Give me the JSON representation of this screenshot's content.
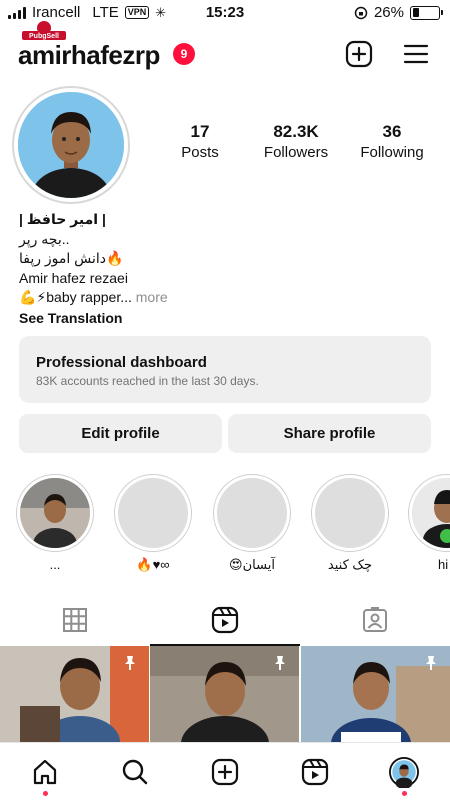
{
  "status_bar": {
    "carrier": "Irancell",
    "network": "LTE",
    "vpn": "VPN",
    "time": "15:23",
    "battery": "26%",
    "battery_level": 0.26
  },
  "header": {
    "logo_text": "PubgSell",
    "username": "amirhafezrp",
    "notification_count": "9",
    "icons": [
      "plus-square-icon",
      "menu-icon"
    ]
  },
  "stats": [
    {
      "value": "17",
      "label": "Posts"
    },
    {
      "value": "82.3K",
      "label": "Followers"
    },
    {
      "value": "36",
      "label": "Following"
    }
  ],
  "bio": {
    "name": "| امیر حافظ |",
    "line1": "بچه رپر..",
    "line2": "دانش اموز رپفا🔥",
    "line3": "Amir hafez rezaei",
    "line4": "💪⚡baby rapper...",
    "more": "more",
    "see_translation": "See Translation"
  },
  "dashboard": {
    "title": "Professional dashboard",
    "subtitle": "83K accounts reached in the last 30 days."
  },
  "buttons": {
    "edit_profile": "Edit profile",
    "share_profile": "Share profile"
  },
  "highlights": [
    {
      "caption": "..."
    },
    {
      "caption": "🔥♥∞"
    },
    {
      "caption": "😍آیسان"
    },
    {
      "caption": "چک کنید"
    },
    {
      "caption": "hi"
    }
  ],
  "tabs": [
    "grid-icon",
    "reels-icon",
    "tagged-icon"
  ],
  "nav": [
    "home-icon",
    "search-icon",
    "create-icon",
    "reels-icon",
    "profile-avatar"
  ],
  "colors": {
    "badge": "#ff0f3c",
    "button_bg": "#efefef",
    "muted_text": "#737373",
    "nav_dot": "#ff2d55"
  }
}
